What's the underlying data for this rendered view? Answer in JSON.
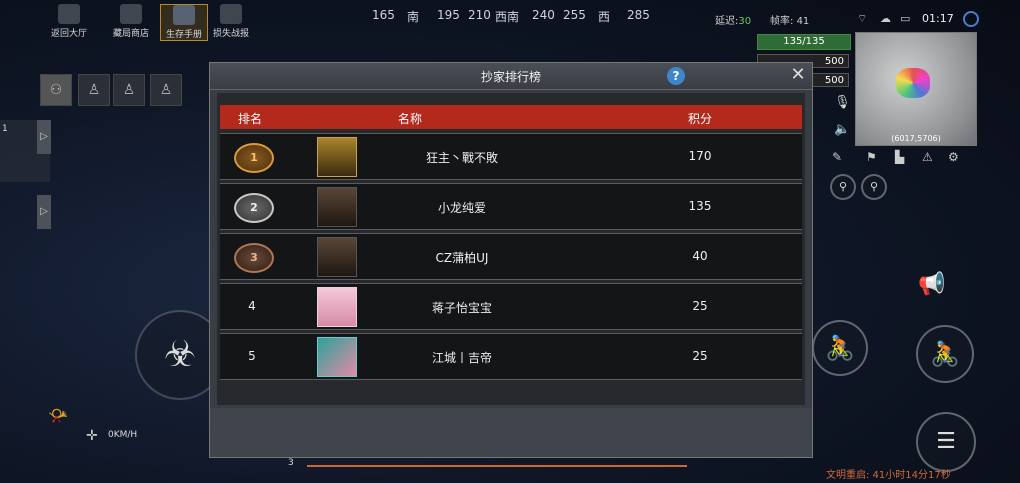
{
  "top_buttons": [
    {
      "label": "返回大厅",
      "icon": "home-icon"
    },
    {
      "label": "藏局商店",
      "icon": "shop-icon"
    },
    {
      "label": "生存手册",
      "icon": "handbook-icon"
    },
    {
      "label": "损失战报",
      "icon": "report-icon"
    }
  ],
  "compass": [
    "165",
    "南",
    "195",
    "210",
    "西南",
    "240",
    "255",
    "西",
    "285"
  ],
  "hud": {
    "latency_label": "延迟:",
    "latency_value": "30",
    "fps_label": "帧率:",
    "fps_value": "41",
    "clock": "01:17",
    "hp": "135/135",
    "bar2": "500",
    "bar3": "500",
    "map_coord": "(6017,5706)",
    "speed": "0KM/H",
    "left_marker": "1",
    "bottom_number": "3",
    "footer_note": "文明重启: 41小时14分17秒"
  },
  "modal": {
    "title": "抄家排行榜",
    "help": "?",
    "close": "✕",
    "columns": {
      "rank": "排名",
      "name": "名称",
      "score": "积分"
    },
    "rows": [
      {
        "rank": "1",
        "name": "狂主丶戰不敗",
        "score": "170",
        "medal": "gold"
      },
      {
        "rank": "2",
        "name": "小龙纯爱",
        "score": "135",
        "medal": "silver"
      },
      {
        "rank": "3",
        "name": "CZ蒲柏UJ",
        "score": "40",
        "medal": "bronze"
      },
      {
        "rank": "4",
        "name": "蒋子怡宝宝",
        "score": "25",
        "medal": ""
      },
      {
        "rank": "5",
        "name": "江城丨吉帝",
        "score": "25",
        "medal": ""
      }
    ]
  },
  "colors": {
    "header_red": "#b32a1c",
    "gold": "#d89a3a",
    "silver": "#c9c9c9",
    "bronze": "#b07555",
    "hp_green": "#2f6b34"
  }
}
